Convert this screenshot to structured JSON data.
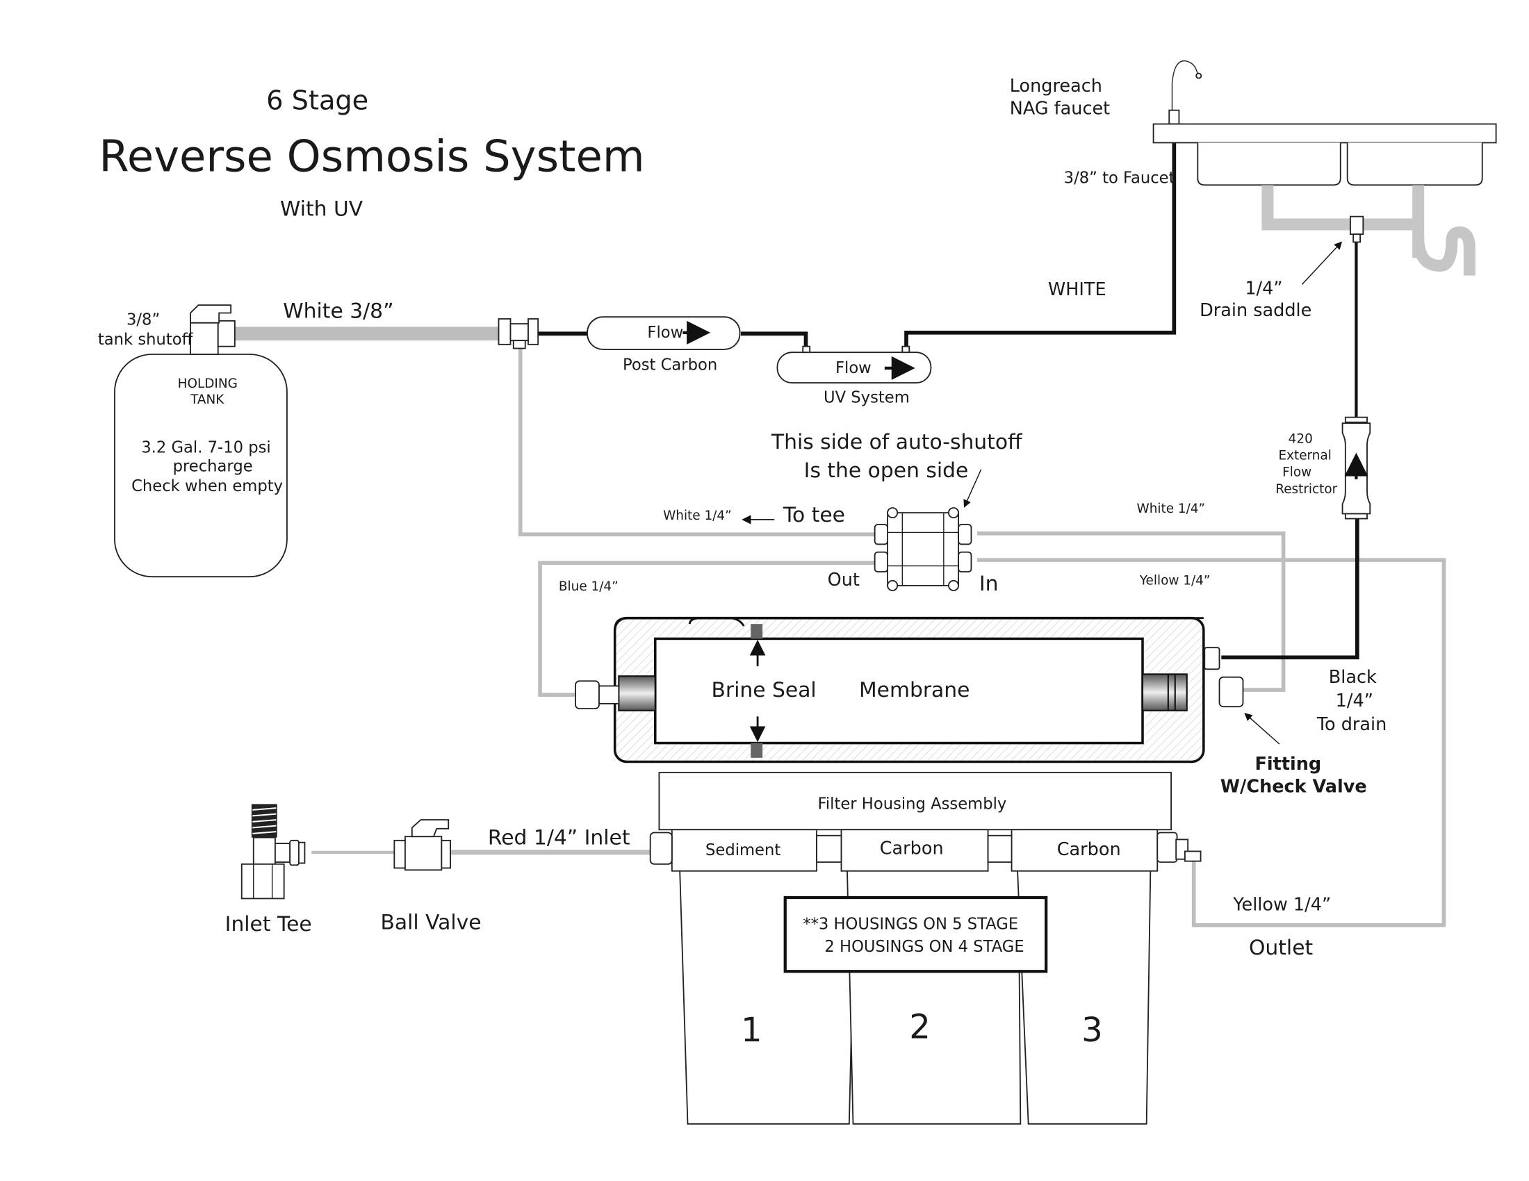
{
  "title": {
    "line1": "6 Stage",
    "line2": "Reverse Osmosis System",
    "line3": "With UV"
  },
  "tank": {
    "shutoff_label_1": "3/8”",
    "shutoff_label_2": "tank shutoff",
    "name_1": "HOLDING",
    "name_2": "TANK",
    "spec_1": "3.2 Gal. 7-10 psi",
    "spec_2": "precharge",
    "spec_3": "Check when empty"
  },
  "lines": {
    "white_38": "White  3/8”",
    "white_upper": "WHITE",
    "to_faucet": "3/8” to Faucet",
    "white_14_left": "White 1/4”",
    "white_14_right": "White 1/4”",
    "blue_14": "Blue 1/4”",
    "yellow_14_upper": "Yellow 1/4”",
    "yellow_14_outlet": "Yellow 1/4”",
    "outlet": "Outlet",
    "red_inlet": "Red 1/4”  Inlet",
    "black_1": "Black",
    "black_2": "1/4”",
    "black_3": "To drain"
  },
  "post_carbon": {
    "flow": "Flow",
    "label": "Post Carbon"
  },
  "uv_system": {
    "flow": "Flow",
    "label": "UV System"
  },
  "faucet": {
    "label_1": "Longreach",
    "label_2": "NAG faucet"
  },
  "drain_saddle": {
    "label_1": "1/4”",
    "label_2": "Drain saddle"
  },
  "restrictor": {
    "label_1": "420",
    "label_2": "External",
    "label_3": "Flow",
    "label_4": "Restrictor"
  },
  "auto_shutoff": {
    "note_1": "This side of auto-shutoff",
    "note_2": "Is the open side",
    "to_tee": "To tee",
    "out": "Out",
    "in": "In"
  },
  "membrane": {
    "brine_seal": "Brine Seal",
    "label": "Membrane"
  },
  "check_valve": {
    "label_1": "Fitting",
    "label_2": "W/Check Valve"
  },
  "filters": {
    "assembly": "Filter Housing Assembly",
    "stages": [
      {
        "name": "Sediment",
        "number": "1"
      },
      {
        "name": "Carbon",
        "number": "2"
      },
      {
        "name": "Carbon",
        "number": "3"
      }
    ],
    "note_1": "**3 HOUSINGS ON 5 STAGE",
    "note_2": "2 HOUSINGS ON 4 STAGE"
  },
  "inlet": {
    "tee": "Inlet Tee",
    "ball_valve": "Ball Valve"
  }
}
